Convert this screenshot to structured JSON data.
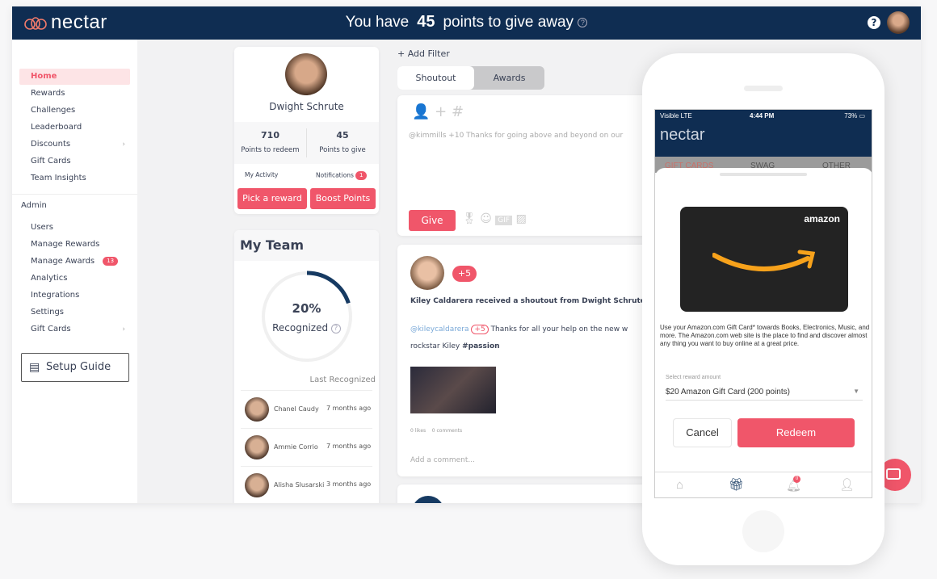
{
  "header": {
    "logo": "nectar",
    "title_pre": "You have",
    "points": "45",
    "title_post": "points to give away",
    "help": "?"
  },
  "sidebar": {
    "items": [
      {
        "label": "Home",
        "active": true
      },
      {
        "label": "Rewards"
      },
      {
        "label": "Challenges"
      },
      {
        "label": "Leaderboard"
      },
      {
        "label": "Discounts",
        "chevron": true
      },
      {
        "label": "Gift Cards"
      },
      {
        "label": "Team Insights"
      }
    ],
    "admin_label": "Admin",
    "admin_items": [
      {
        "label": "Users"
      },
      {
        "label": "Manage Rewards"
      },
      {
        "label": "Manage Awards",
        "badge": "13"
      },
      {
        "label": "Analytics"
      },
      {
        "label": "Integrations"
      },
      {
        "label": "Settings"
      },
      {
        "label": "Gift Cards",
        "chevron": true
      }
    ],
    "setup_guide": "Setup Guide"
  },
  "profile": {
    "name": "Dwight Schrute",
    "redeem_value": "710",
    "redeem_label": "Points to redeem",
    "give_value": "45",
    "give_label": "Points to give",
    "my_activity": "My Activity",
    "notifications": "Notifications",
    "notifications_count": "1",
    "pick_reward": "Pick a reward",
    "boost_points": "Boost Points"
  },
  "team": {
    "title": "My Team",
    "percent": "20%",
    "recognized_fraction": 0.2,
    "recognized_label": "Recognized",
    "last_recognized": "Last Recognized",
    "members": [
      {
        "name": "Chanel Caudy",
        "time": "7 months ago"
      },
      {
        "name": "Ammie Corrio",
        "time": "7 months ago"
      },
      {
        "name": "Alisha Slusarski",
        "time": "3 months ago"
      }
    ]
  },
  "feed": {
    "add_filter": "+ Add Filter",
    "tabs": [
      "Shoutout",
      "Awards"
    ],
    "composer_placeholder": "@kimmills +10 Thanks for going above and beyond on our",
    "give": "Give",
    "gif": "GIF",
    "post": {
      "points": "+5",
      "headline": "Kiley Caldarera received a shoutout from Dwight Schrute",
      "mention": "@kileycaldarera",
      "inline_points": "+5",
      "text": "Thanks for all your help on the new w",
      "text2": "rockstar Kiley",
      "hashtag": "#passion",
      "likes": "0 likes",
      "comments": "0 comments",
      "comment_placeholder": "Add a comment..."
    }
  },
  "phone": {
    "carrier": "Visible  LTE",
    "time": "4:44 PM",
    "battery": "73%",
    "logo": "nectar",
    "tabs": [
      "GIFT CARDS",
      "SWAG",
      "OTHER"
    ],
    "brand": "amazon",
    "description": "Use your Amazon.com Gift Card* towards Books, Electronics, Music, and more. The Amazon.com web site is the place to find and discover almost any thing you want to buy online at a great price.",
    "select_label": "Select reward amount",
    "select_value": "$20 Amazon Gift Card (200 points)",
    "cancel": "Cancel",
    "redeem": "Redeem",
    "bell_count": "0"
  },
  "colors": {
    "navy": "#0f2d52",
    "accent": "#f0566a",
    "amazon_orange": "#f7a21b"
  }
}
